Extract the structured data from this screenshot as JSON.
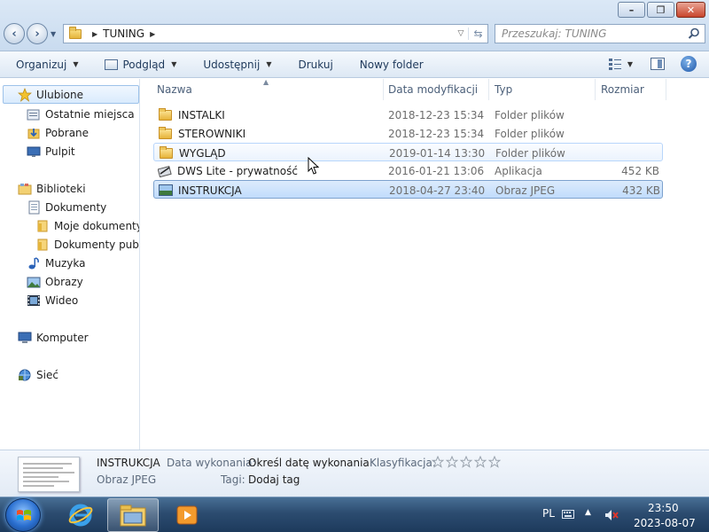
{
  "window": {
    "breadcrumb": [
      "TUNING"
    ],
    "search_placeholder": "Przeszukaj: TUNING",
    "controls": {
      "minimize": "–",
      "maximize": "❐",
      "close": "✕"
    }
  },
  "toolbar": {
    "organize": "Organizuj",
    "preview": "Podgląd",
    "share": "Udostępnij",
    "print": "Drukuj",
    "new_folder": "Nowy folder",
    "help": "?"
  },
  "sidebar": {
    "favorites": "Ulubione",
    "recent": "Ostatnie miejsca",
    "downloads": "Pobrane",
    "desktop": "Pulpit",
    "libraries": "Biblioteki",
    "documents": "Dokumenty",
    "my_documents": "Moje dokumenty",
    "public_documents": "Dokumenty public",
    "music": "Muzyka",
    "pictures": "Obrazy",
    "videos": "Wideo",
    "computer": "Komputer",
    "network": "Sieć"
  },
  "columns": {
    "name": "Nazwa",
    "date": "Data modyfikacji",
    "type": "Typ",
    "size": "Rozmiar"
  },
  "files": [
    {
      "name": "INSTALKI",
      "date": "2018-12-23 15:34",
      "type": "Folder plików",
      "size": "",
      "icon": "folder-icon"
    },
    {
      "name": "STEROWNIKI",
      "date": "2018-12-23 15:34",
      "type": "Folder plików",
      "size": "",
      "icon": "folder-icon"
    },
    {
      "name": "WYGLĄD",
      "date": "2019-01-14 13:30",
      "type": "Folder plików",
      "size": "",
      "icon": "folder-icon"
    },
    {
      "name": "DWS Lite - prywatność",
      "date": "2016-01-21 13:06",
      "type": "Aplikacja",
      "size": "452 KB",
      "icon": "application-icon"
    },
    {
      "name": "INSTRUKCJA",
      "date": "2018-04-27 23:40",
      "type": "Obraz JPEG",
      "size": "432 KB",
      "icon": "image-icon"
    }
  ],
  "details": {
    "file_name": "INSTRUKCJA",
    "file_type": "Obraz JPEG",
    "date_label": "Data wykonania:",
    "date_value": "Określ datę wykonania",
    "tags_label": "Tagi:",
    "tags_value": "Dodaj tag",
    "rating_label": "Klasyfikacja:",
    "rating": 0
  },
  "taskbar": {
    "language": "PL",
    "time": "23:50",
    "date": "2023-08-07"
  },
  "colors": {
    "selection": "#c1dcfc",
    "taskbar": "#2c4c70",
    "accent": "#1d56a8"
  }
}
